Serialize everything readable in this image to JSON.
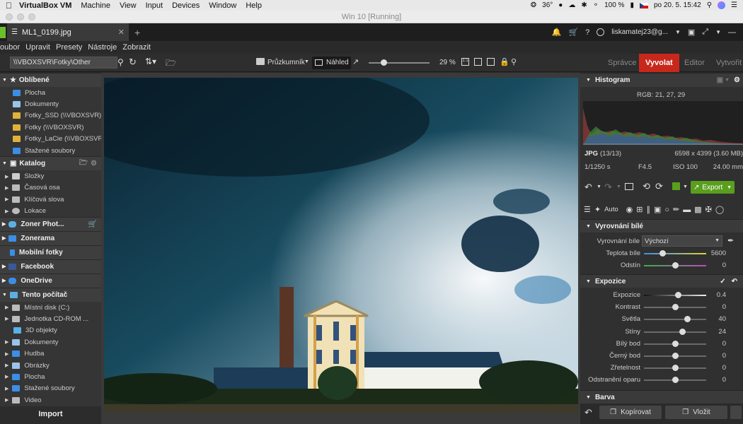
{
  "mac": {
    "app": "VirtualBox VM",
    "menus": [
      "Machine",
      "View",
      "Input",
      "Devices",
      "Window",
      "Help"
    ],
    "temp": "36°",
    "battery": "100 %",
    "datetime": "po 20. 5.  15:42"
  },
  "window": {
    "title": "Win 10 [Running]"
  },
  "app": {
    "doc_tab": "ML1_0199.jpg",
    "new_tab": "+",
    "user": "liskamatej23@g..."
  },
  "menu": [
    "oubor",
    "Upravit",
    "Presety",
    "Nástroje",
    "Zobrazit"
  ],
  "toolbar": {
    "path": "\\\\VBOXSVR\\Fotky\\Other",
    "browser_label": "Průzkumník",
    "preview_label": "Náhled",
    "zoom": "29 %",
    "modes": [
      "Správce",
      "Vyvolat",
      "Editor",
      "Vytvořit"
    ],
    "active_mode": "Vyvolat"
  },
  "sidebar": {
    "oblibene": {
      "title": "Oblíbené",
      "items": [
        "Plocha",
        "Dokumenty",
        "Fotky_SSD (\\\\VBOXSVR)",
        "Fotky (\\\\VBOXSVR)",
        "Fotky_LaCie (\\\\VBOXSVR)",
        "Stažené soubory"
      ]
    },
    "katalog": {
      "title": "Katalog",
      "items": [
        "Složky",
        "Časová osa",
        "Klíčová slova",
        "Lokace"
      ]
    },
    "zoner_photo": "Zoner Phot...",
    "zonerama": "Zonerama",
    "mobilni": "Mobilní fotky",
    "facebook": "Facebook",
    "onedrive": "OneDrive",
    "pc": {
      "title": "Tento počítač",
      "items": [
        "Místní disk (C:)",
        "Jednotka CD-ROM ...",
        "3D objekty",
        "Dokumenty",
        "Hudba",
        "Obrázky",
        "Plocha",
        "Stažené soubory",
        "Video"
      ]
    },
    "import": "Import"
  },
  "histogram": {
    "title": "Histogram",
    "rgb": "RGB: 21, 27, 29",
    "format": "JPG",
    "count": "(13/13)",
    "dims": "6598 x 4399 (3.60 MB)",
    "shutter": "1/1250 s",
    "aperture": "F4.5",
    "iso": "ISO 100",
    "focal": "24.00 mm"
  },
  "actions": {
    "export": "Export",
    "auto": "Auto"
  },
  "wb": {
    "title": "Vyrovnání bílé",
    "select_label": "Vyrovnání bíle",
    "select_value": "Výchozí",
    "rows": [
      {
        "label": "Teplota bíle",
        "value": "5600",
        "pos": 0.3
      },
      {
        "label": "Odstín",
        "value": "0",
        "pos": 0.5
      }
    ]
  },
  "exposure": {
    "title": "Expozice",
    "rows": [
      {
        "label": "Expozice",
        "value": "0.4",
        "pos": 0.55
      },
      {
        "label": "Kontrast",
        "value": "0",
        "pos": 0.5
      },
      {
        "label": "Světla",
        "value": "40",
        "pos": 0.7
      },
      {
        "label": "Stíny",
        "value": "24",
        "pos": 0.62
      },
      {
        "label": "Bílý bod",
        "value": "0",
        "pos": 0.5
      },
      {
        "label": "Černý bod",
        "value": "0",
        "pos": 0.5
      },
      {
        "label": "Zřetelnost",
        "value": "0",
        "pos": 0.5
      },
      {
        "label": "Odstranění oparu",
        "value": "0",
        "pos": 0.5
      }
    ]
  },
  "barva": {
    "title": "Barva"
  },
  "bottom": {
    "copy": "Kopírovat",
    "paste": "Vložit"
  },
  "colors": {
    "accent": "#c8281c",
    "export": "#5a9e1e",
    "folder": "#e0b23a",
    "blue": "#3a8ee6"
  }
}
